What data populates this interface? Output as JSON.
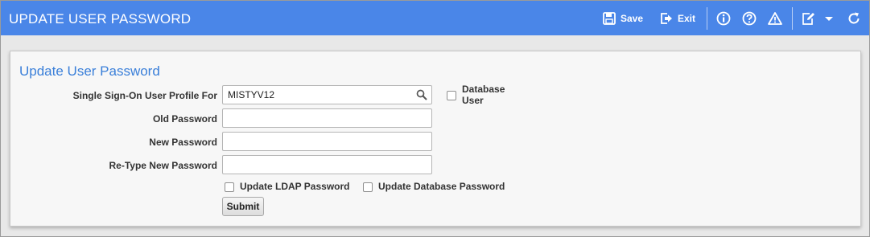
{
  "window": {
    "title": "UPDATE USER PASSWORD",
    "accent_color": "#4a86e8"
  },
  "toolbar": {
    "save_label": "Save",
    "exit_label": "Exit",
    "icons": [
      "save-icon",
      "exit-icon",
      "info-icon",
      "help-icon",
      "warning-icon",
      "edit-icon",
      "dropdown-icon",
      "refresh-icon"
    ]
  },
  "form": {
    "heading": "Update User Password",
    "sso_label": "Single Sign-On User Profile For",
    "sso_value": "MISTYV12",
    "database_user_label": "Database User",
    "database_user_label_line1": "Database",
    "database_user_label_line2": "User",
    "old_password_label": "Old Password",
    "old_password_value": "",
    "new_password_label": "New Password",
    "new_password_value": "",
    "retype_password_label": "Re-Type New Password",
    "retype_password_value": "",
    "update_ldap_label": "Update LDAP Password",
    "update_db_label": "Update Database Password",
    "submit_label": "Submit"
  }
}
